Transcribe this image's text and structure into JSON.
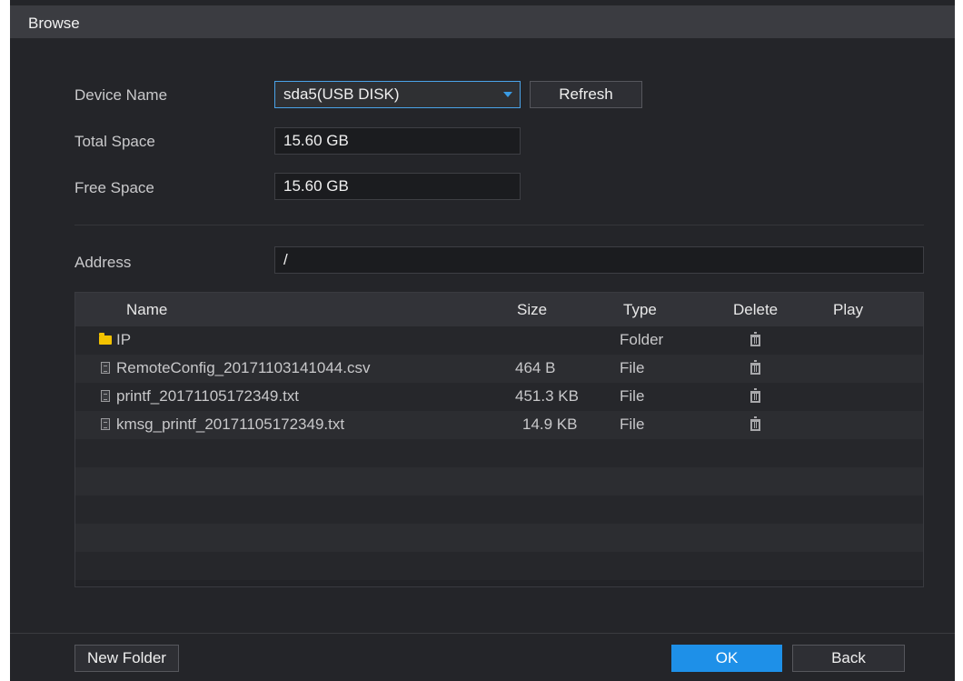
{
  "window": {
    "title": "Browse"
  },
  "form": {
    "device_name_label": "Device Name",
    "device_name_value": "sda5(USB DISK)",
    "refresh_label": "Refresh",
    "total_space_label": "Total Space",
    "total_space_value": "15.60 GB",
    "free_space_label": "Free Space",
    "free_space_value": "15.60 GB",
    "address_label": "Address",
    "address_value": "/"
  },
  "table": {
    "columns": {
      "name": "Name",
      "size": "Size",
      "type": "Type",
      "delete": "Delete",
      "play": "Play"
    },
    "rows": [
      {
        "icon": "folder-icon",
        "name": "IP",
        "size": "",
        "type": "Folder"
      },
      {
        "icon": "file-icon",
        "name": "RemoteConfig_20171103141044.csv",
        "size": "464 B",
        "type": "File"
      },
      {
        "icon": "file-icon",
        "name": "printf_20171105172349.txt",
        "size": "451.3 KB",
        "type": "File"
      },
      {
        "icon": "file-icon",
        "name": "kmsg_printf_20171105172349.txt",
        "size": "14.9 KB",
        "type": "File"
      }
    ]
  },
  "footer": {
    "new_folder_label": "New Folder",
    "ok_label": "OK",
    "back_label": "Back"
  },
  "colors": {
    "accent": "#1e90e8",
    "folder": "#f3c200",
    "background": "#242529"
  }
}
